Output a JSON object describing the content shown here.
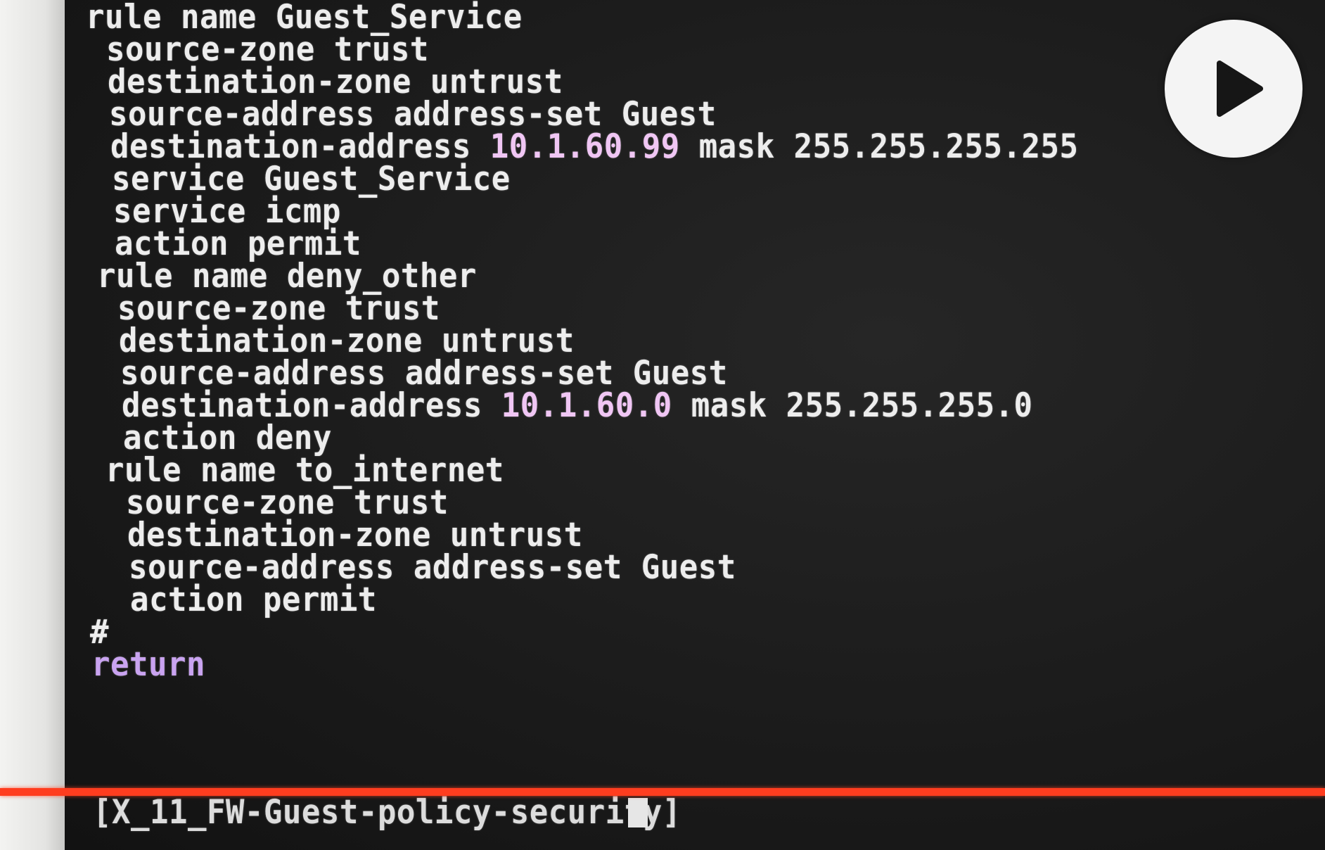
{
  "terminal": {
    "lines": [
      "rule name Guest_Service",
      " source-zone trust",
      " destination-zone untrust",
      " source-address address-set Guest",
      " destination-address ",
      " service Guest_Service",
      " service icmp",
      " action permit",
      "rule name deny_other",
      " source-zone trust",
      " destination-zone untrust",
      " source-address address-set Guest",
      " destination-address ",
      " action deny",
      "rule name to_internet",
      " source-zone trust",
      " destination-zone untrust",
      " source-address address-set Guest",
      " action permit",
      "#",
      "return"
    ],
    "rule1_dest_ip": "10.1.60.99",
    "rule1_dest_mask": " mask 255.255.255.255",
    "rule2_dest_ip": "10.1.60.0",
    "rule2_dest_mask": " mask 255.255.255.0",
    "prompt": "[X_11_FW-Guest-policy-security]"
  },
  "player": {
    "play_icon": "play-icon"
  },
  "colors": {
    "terminal_bg": "#1b1b1b",
    "text": "#ededed",
    "ip_highlight": "#f0c6f4",
    "keyword_return": "#c9a3f0",
    "progress_bar": "#ff3d1f"
  }
}
